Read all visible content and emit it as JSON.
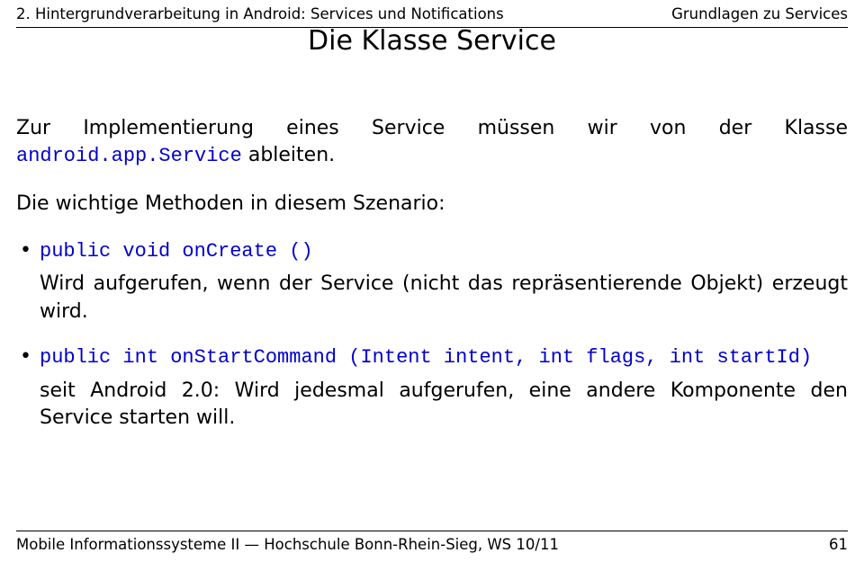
{
  "header": {
    "left": "2. Hintergrundverarbeitung in Android: Services und Notifications",
    "right": "Grundlagen zu Services"
  },
  "title": "Die Klasse Service",
  "intro": {
    "pre": "Zur Implementierung eines Service müssen wir von der Klasse ",
    "code": "android.app.Service",
    "post": " ableiten."
  },
  "scenario_line": "Die wichtige Methoden in diesem Szenario:",
  "bullets": [
    {
      "code": "public void onCreate ()",
      "desc": "Wird aufgerufen, wenn der Service (nicht das repräsentierende Objekt) erzeugt wird."
    },
    {
      "code": "public int onStartCommand (Intent intent, int flags, int startId)",
      "desc": "seit Android 2.0: Wird jedesmal aufgerufen, eine andere Komponente den Service starten will."
    }
  ],
  "footer": {
    "left": "Mobile Informationssysteme II — Hochschule Bonn-Rhein-Sieg, WS 10/11",
    "right": "61"
  }
}
